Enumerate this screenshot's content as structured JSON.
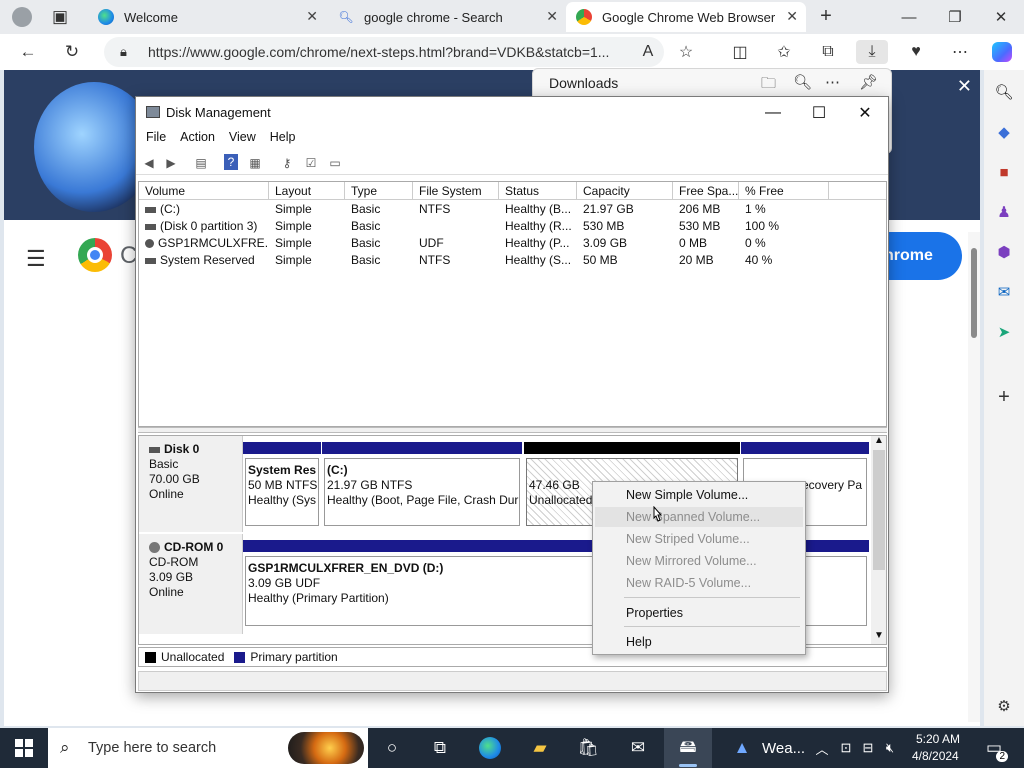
{
  "browser": {
    "tabs": [
      {
        "title": "Welcome",
        "icon": "edge-icon"
      },
      {
        "title": "google chrome - Search",
        "icon": "search-icon"
      },
      {
        "title": "Google Chrome Web Browser",
        "icon": "chrome-icon",
        "active": true
      }
    ],
    "url": "https://www.google.com/chrome/next-steps.html?brand=VDKB&statcb=1...",
    "page_button": "hrome",
    "page_logo_fragment": "C"
  },
  "downloads": {
    "title": "Downloads"
  },
  "disk_management": {
    "title": "Disk Management",
    "menu": [
      "File",
      "Action",
      "View",
      "Help"
    ],
    "columns": [
      "Volume",
      "Layout",
      "Type",
      "File System",
      "Status",
      "Capacity",
      "Free Spa...",
      "% Free"
    ],
    "volumes": [
      {
        "volume": "(C:)",
        "layout": "Simple",
        "type": "Basic",
        "fs": "NTFS",
        "status": "Healthy (B...",
        "capacity": "21.97 GB",
        "free": "206 MB",
        "pct": "1 %"
      },
      {
        "volume": "(Disk 0 partition 3)",
        "layout": "Simple",
        "type": "Basic",
        "fs": "",
        "status": "Healthy (R...",
        "capacity": "530 MB",
        "free": "530 MB",
        "pct": "100 %"
      },
      {
        "volume": "GSP1RMCULXFRE...",
        "layout": "Simple",
        "type": "Basic",
        "fs": "UDF",
        "status": "Healthy (P...",
        "capacity": "3.09 GB",
        "free": "0 MB",
        "pct": "0 %"
      },
      {
        "volume": "System Reserved",
        "layout": "Simple",
        "type": "Basic",
        "fs": "NTFS",
        "status": "Healthy (S...",
        "capacity": "50 MB",
        "free": "20 MB",
        "pct": "40 %"
      }
    ],
    "disk0": {
      "name": "Disk 0",
      "kind": "Basic",
      "size": "70.00 GB",
      "state": "Online",
      "parts": {
        "sysres": {
          "name": "System Res",
          "line2": "50 MB NTFS",
          "line3": "Healthy (Sys"
        },
        "c": {
          "name": "(C:)",
          "line2": "21.97 GB NTFS",
          "line3": "Healthy (Boot, Page File, Crash Dur"
        },
        "unalloc": {
          "line1": "47.46 GB",
          "line2": "Unallocated"
        },
        "recovery": {
          "line2": "ecovery Pa"
        }
      }
    },
    "cdrom": {
      "name": "CD-ROM 0",
      "kind": "CD-ROM",
      "size": "3.09 GB",
      "state": "Online",
      "part": {
        "name": "GSP1RMCULXFRER_EN_DVD  (D:)",
        "line2": "3.09 GB UDF",
        "line3": "Healthy (Primary Partition)"
      }
    },
    "legend": {
      "unallocated": "Unallocated",
      "primary": "Primary partition"
    },
    "colors": {
      "primary": "#1a1a8c",
      "unallocated": "#000000"
    }
  },
  "context_menu": {
    "items": [
      {
        "label": "New Simple Volume...",
        "enabled": true
      },
      {
        "label": "New Spanned Volume...",
        "enabled": false
      },
      {
        "label": "New Striped Volume...",
        "enabled": false
      },
      {
        "label": "New Mirrored Volume...",
        "enabled": false
      },
      {
        "label": "New RAID-5 Volume...",
        "enabled": false
      },
      {
        "label": "Properties",
        "enabled": true
      },
      {
        "label": "Help",
        "enabled": true
      }
    ]
  },
  "taskbar": {
    "search_placeholder": "Type here to search",
    "weather_label": "Wea...",
    "time": "5:20 AM",
    "date": "4/8/2024",
    "notification_count": "2"
  }
}
